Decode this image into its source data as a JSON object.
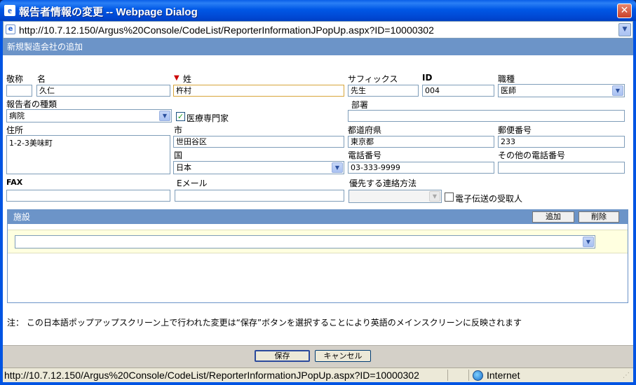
{
  "window": {
    "title": "報告者情報の変更 -- Webpage Dialog",
    "icon": "ie-icon",
    "close_label": "✕"
  },
  "address_bar": {
    "url": "http://10.7.12.150/Argus%20Console/CodeList/ReporterInformationJPopUp.aspx?ID=10000302"
  },
  "page": {
    "header": "新規製造会社の追加"
  },
  "form": {
    "honorific_label": "敬称",
    "honorific_value": "",
    "first_name_label": "名",
    "first_name_value": "久仁",
    "last_name_label": "姓",
    "last_name_value": "杵村",
    "suffix_label": "サフィックス",
    "suffix_value": "先生",
    "id_label": "ID",
    "id_value": "004",
    "occupation_label": "職種",
    "occupation_value": "医師",
    "reporter_type_label": "報告者の種類",
    "reporter_type_value": "病院",
    "hcp_label": "医療専門家",
    "hcp_checked": true,
    "department_label": "部署",
    "department_value": "",
    "address_label": "住所",
    "address_value": "1-2-3美味町",
    "city_label": "市",
    "city_value": "世田谷区",
    "prefecture_label": "都道府県",
    "prefecture_value": "東京都",
    "postal_label": "郵便番号",
    "postal_value": "233",
    "country_label": "国",
    "country_value": "日本",
    "phone_label": "電話番号",
    "phone_value": "03-333-9999",
    "other_phone_label": "その他の電話番号",
    "other_phone_value": "",
    "fax_label": "FAX",
    "fax_value": "",
    "email_label": "Eメール",
    "email_value": "",
    "preferred_contact_label": "優先する連絡方法",
    "preferred_contact_value": "",
    "e2b_label": "電子伝送の受取人",
    "e2b_checked": false
  },
  "facilities": {
    "header": "施設",
    "add_label": "追加",
    "delete_label": "削除",
    "row_value": ""
  },
  "note": "注：  この日本語ポップアップスクリーン上で行われた変更は“保存”ボタンを選択することにより英語のメインスクリーンに反映されます",
  "footer": {
    "save_label": "保存",
    "cancel_label": "キャンセル"
  },
  "status_bar": {
    "url": "http://10.7.12.150/Argus%20Console/CodeList/ReporterInformationJPopUp.aspx?ID=10000302",
    "zone": "Internet"
  }
}
